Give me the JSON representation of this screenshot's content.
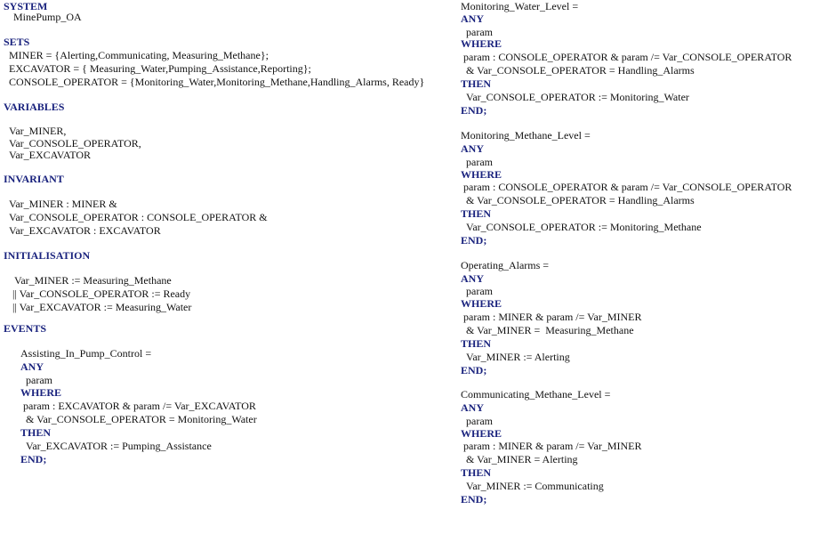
{
  "keyword_color": "#1a237e",
  "left_column": [
    {
      "text": "SYSTEM",
      "kw": true
    },
    {
      "text": "MinePump_OA",
      "kw": false
    },
    {
      "text": "SETS",
      "kw": true
    },
    {
      "text": "MINER = {Alerting,Communicating, Measuring_Methane};",
      "kw": false
    },
    {
      "text": "EXCAVATOR = { Measuring_Water,Pumping_Assistance,Reporting};",
      "kw": false
    },
    {
      "text": "CONSOLE_OPERATOR = {Monitoring_Water,Monitoring_Methane,Handling_Alarms, Ready}",
      "kw": false
    },
    {
      "text": "VARIABLES",
      "kw": true
    },
    {
      "text": "Var_MINER,",
      "kw": false
    },
    {
      "text": "Var_CONSOLE_OPERATOR,",
      "kw": false
    },
    {
      "text": "Var_EXCAVATOR",
      "kw": false
    },
    {
      "text": "INVARIANT",
      "kw": true
    },
    {
      "text": "Var_MINER : MINER &",
      "kw": false
    },
    {
      "text": "Var_CONSOLE_OPERATOR : CONSOLE_OPERATOR &",
      "kw": false
    },
    {
      "text": "Var_EXCAVATOR : EXCAVATOR",
      "kw": false
    },
    {
      "text": "INITIALISATION",
      "kw": true
    },
    {
      "text": "Var_MINER := Measuring_Methane",
      "kw": false
    },
    {
      "text": "|| Var_CONSOLE_OPERATOR := Ready",
      "kw": false
    },
    {
      "text": "|| Var_EXCAVATOR := Measuring_Water",
      "kw": false
    },
    {
      "text": "EVENTS",
      "kw": true
    },
    {
      "text": "Assisting_In_Pump_Control =",
      "kw": false
    },
    {
      "text": "ANY",
      "kw": true
    },
    {
      "text": "param",
      "kw": false
    },
    {
      "text": "WHERE",
      "kw": true
    },
    {
      "text": "param : EXCAVATOR & param /= Var_EXCAVATOR",
      "kw": false
    },
    {
      "text": "& Var_CONSOLE_OPERATOR = Monitoring_Water",
      "kw": false
    },
    {
      "text": "THEN",
      "kw": true
    },
    {
      "text": "Var_EXCAVATOR := Pumping_Assistance",
      "kw": false
    },
    {
      "text": "END;",
      "kw": true
    }
  ],
  "right_column": [
    {
      "text": "Monitoring_Water_Level =",
      "kw": false
    },
    {
      "text": "ANY",
      "kw": true
    },
    {
      "text": "param",
      "kw": false
    },
    {
      "text": "WHERE",
      "kw": true
    },
    {
      "text": "param : CONSOLE_OPERATOR & param /= Var_CONSOLE_OPERATOR",
      "kw": false
    },
    {
      "text": "& Var_CONSOLE_OPERATOR = Handling_Alarms",
      "kw": false
    },
    {
      "text": "THEN",
      "kw": true
    },
    {
      "text": "Var_CONSOLE_OPERATOR := Monitoring_Water",
      "kw": false
    },
    {
      "text": "END;",
      "kw": true
    },
    {
      "text": "Monitoring_Methane_Level =",
      "kw": false
    },
    {
      "text": "ANY",
      "kw": true
    },
    {
      "text": "param",
      "kw": false
    },
    {
      "text": "WHERE",
      "kw": true
    },
    {
      "text": "param : CONSOLE_OPERATOR & param /= Var_CONSOLE_OPERATOR",
      "kw": false
    },
    {
      "text": "& Var_CONSOLE_OPERATOR = Handling_Alarms",
      "kw": false
    },
    {
      "text": "THEN",
      "kw": true
    },
    {
      "text": "Var_CONSOLE_OPERATOR := Monitoring_Methane",
      "kw": false
    },
    {
      "text": "END;",
      "kw": true
    },
    {
      "text": "Operating_Alarms =",
      "kw": false
    },
    {
      "text": "ANY",
      "kw": true
    },
    {
      "text": "param",
      "kw": false
    },
    {
      "text": "WHERE",
      "kw": true
    },
    {
      "text": "param : MINER & param /= Var_MINER",
      "kw": false
    },
    {
      "text": "& Var_MINER =  Measuring_Methane",
      "kw": false
    },
    {
      "text": "THEN",
      "kw": true
    },
    {
      "text": "Var_MINER := Alerting",
      "kw": false
    },
    {
      "text": "END;",
      "kw": true
    },
    {
      "text": "Communicating_Methane_Level =",
      "kw": false
    },
    {
      "text": "ANY",
      "kw": true
    },
    {
      "text": "param",
      "kw": false
    },
    {
      "text": "WHERE",
      "kw": true
    },
    {
      "text": "param : MINER & param /= Var_MINER",
      "kw": false
    },
    {
      "text": "& Var_MINER = Alerting",
      "kw": false
    },
    {
      "text": "THEN",
      "kw": true
    },
    {
      "text": "Var_MINER := Communicating",
      "kw": false
    },
    {
      "text": "END;",
      "kw": true
    }
  ]
}
